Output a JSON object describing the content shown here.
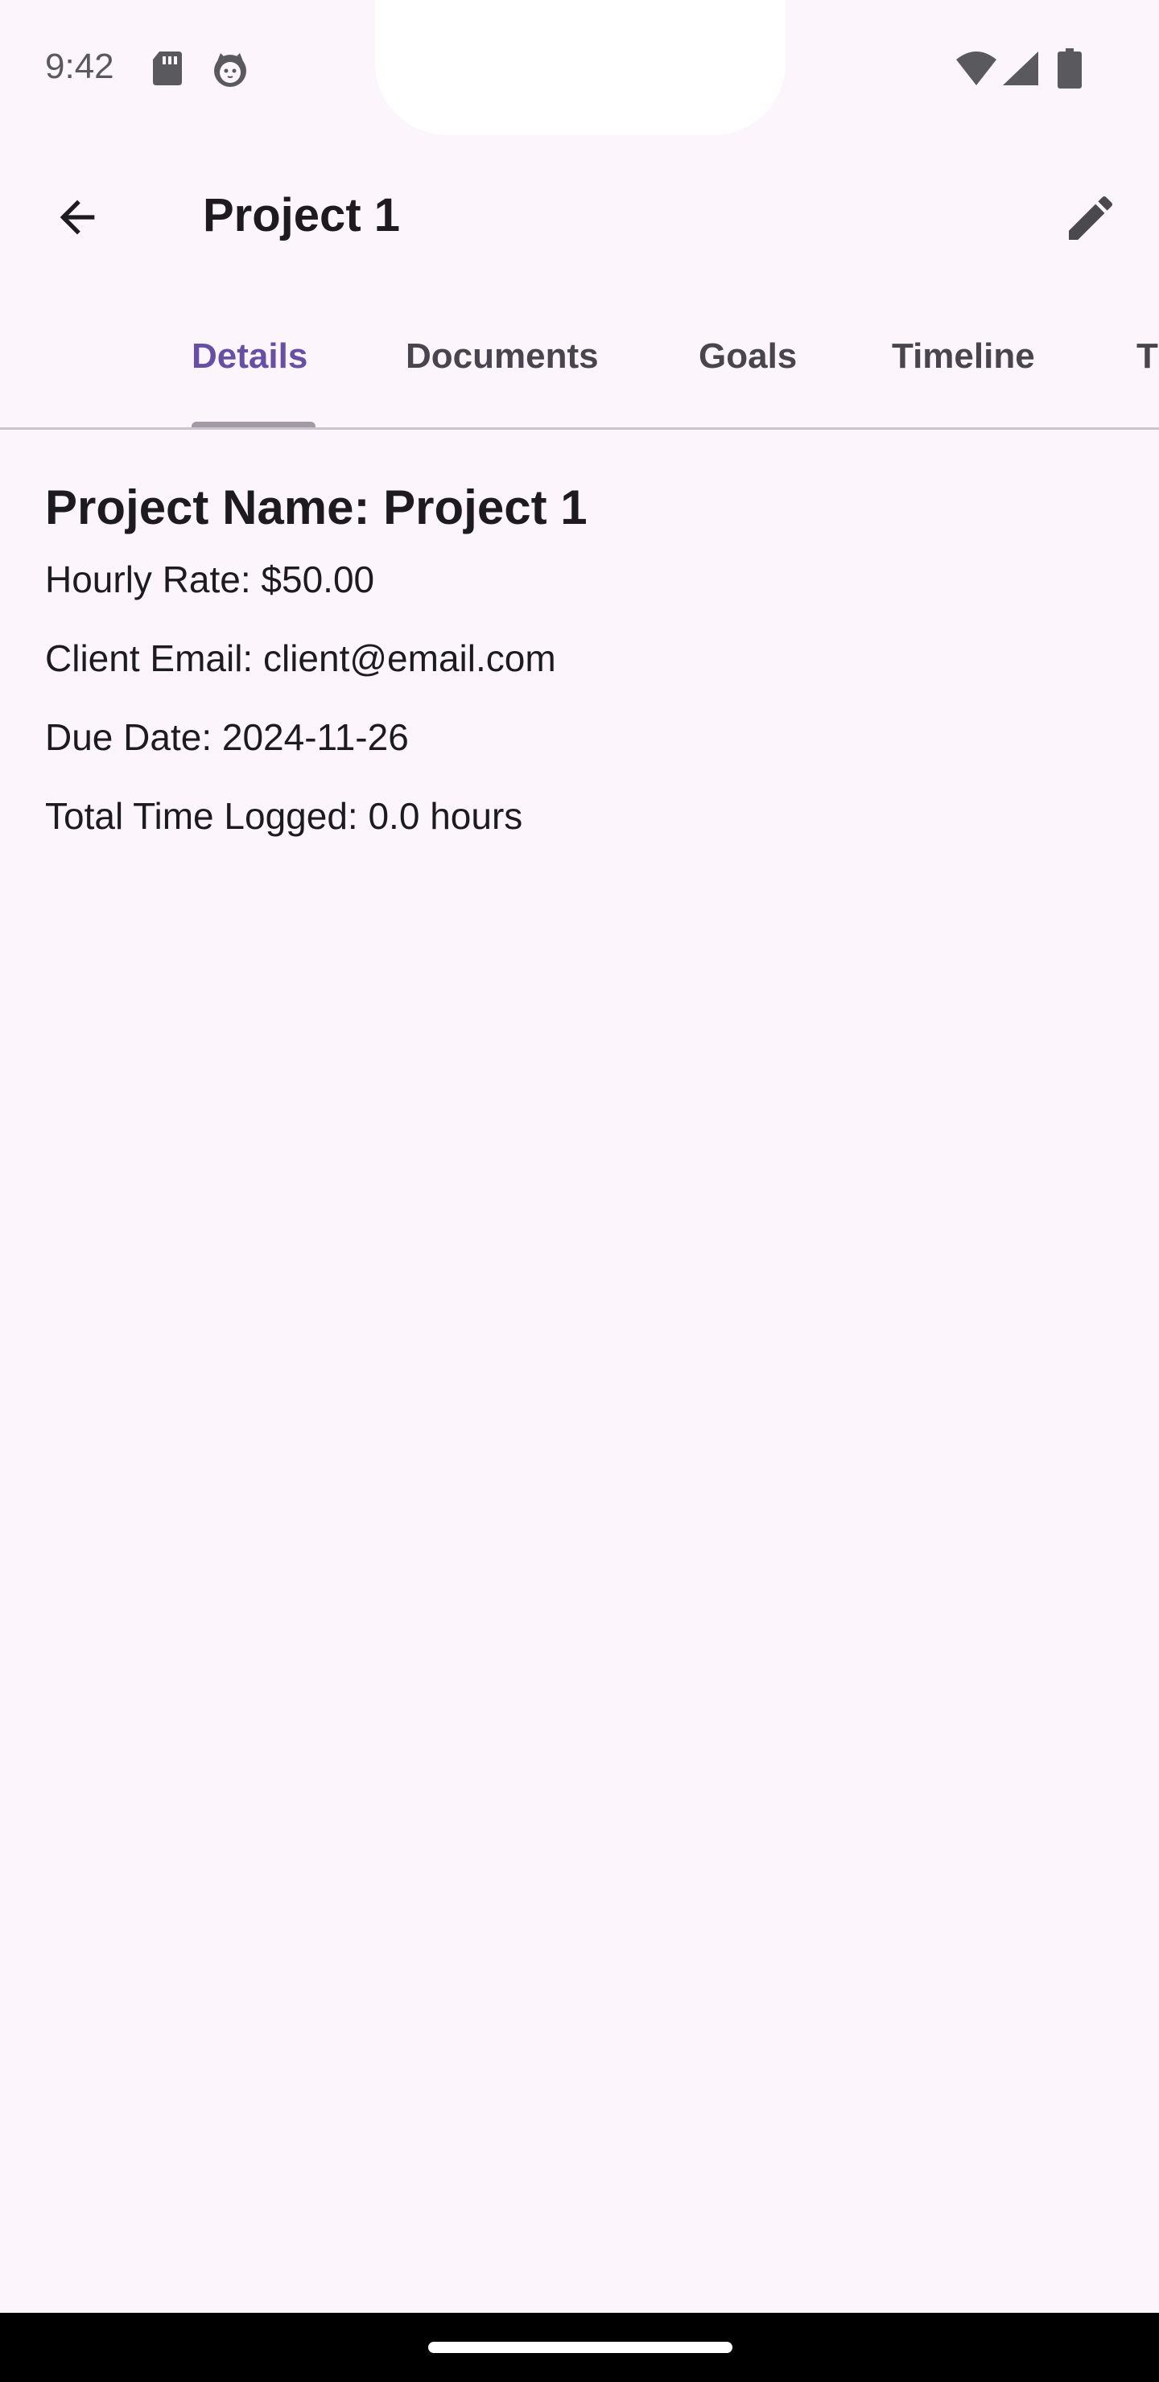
{
  "status_bar": {
    "time": "9:42",
    "icons": [
      "sd-card-icon",
      "cat-face-icon",
      "wifi-icon",
      "signal-icon",
      "battery-icon"
    ]
  },
  "app_bar": {
    "title": "Project 1",
    "back_icon": "arrow-back-icon",
    "edit_icon": "pencil-icon"
  },
  "tabs": [
    {
      "label": "Details",
      "active": true
    },
    {
      "label": "Documents",
      "active": false
    },
    {
      "label": "Goals",
      "active": false
    },
    {
      "label": "Timeline",
      "active": false
    },
    {
      "label": "T",
      "active": false
    }
  ],
  "details": {
    "project_name": "Project Name: Project 1",
    "hourly_rate": "Hourly Rate: $50.00",
    "client_email": "Client Email: client@email.com",
    "due_date": "Due Date: 2024-11-26",
    "total_time": "Total Time Logged: 0.0 hours"
  },
  "colors": {
    "background": "#fcf5fc",
    "accent": "#6750a4",
    "text": "#1d1b20"
  }
}
